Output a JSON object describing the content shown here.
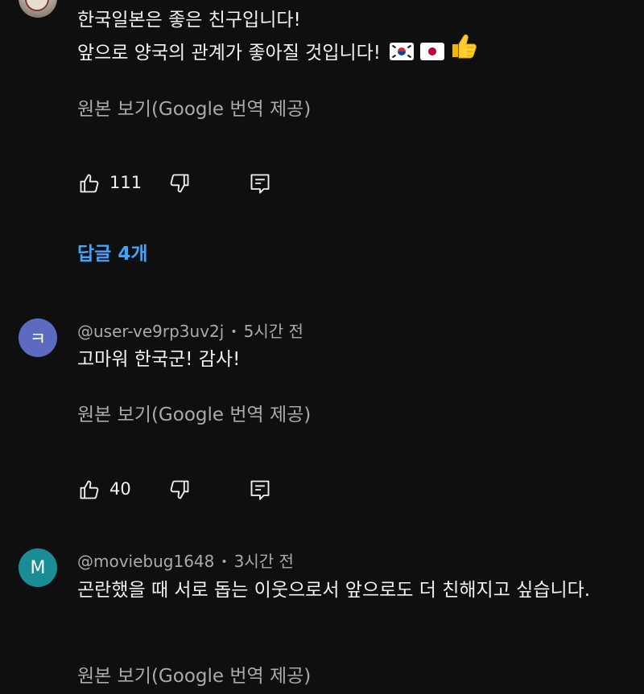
{
  "comments": [
    {
      "avatar_type": "photo",
      "avatar_icon": "profile-photo",
      "lines": [
        "한국일본은 좋은 친구입니다!",
        "앞으로 양국의 관계가 좋아질 것입니다! "
      ],
      "emojis": [
        "korea-flag",
        "japan-flag",
        "thumbs-up-emoji"
      ],
      "translate_label": "원본 보기(Google 번역 제공)",
      "like_count": "111",
      "replies_label": "답글 4개"
    },
    {
      "avatar_letter": "ㅋ",
      "avatar_color": "#5c6bc0",
      "handle": "@user-ve9rp3uv2j",
      "separator": "•",
      "time": "5시간 전",
      "text": "고마워 한국군! 감사!",
      "translate_label": "원본 보기(Google 번역 제공)",
      "like_count": "40"
    },
    {
      "avatar_letter": "M",
      "avatar_color": "#1a8c95",
      "handle": "@moviebug1648",
      "separator": "•",
      "time": "3시간 전",
      "text": "곤란했을 때 서로 돕는 이웃으로서 앞으로도 더 친해지고 싶습니다.",
      "translate_label": "원본 보기(Google 번역 제공)"
    }
  ],
  "icons": {
    "like": "thumbs-up-icon",
    "dislike": "thumbs-down-icon",
    "reply": "reply-comment-icon"
  },
  "colors": {
    "background": "#0f0f0f",
    "text_primary": "#f1f1f1",
    "text_secondary": "#aaaaaa",
    "link_blue": "#3ea6ff"
  }
}
